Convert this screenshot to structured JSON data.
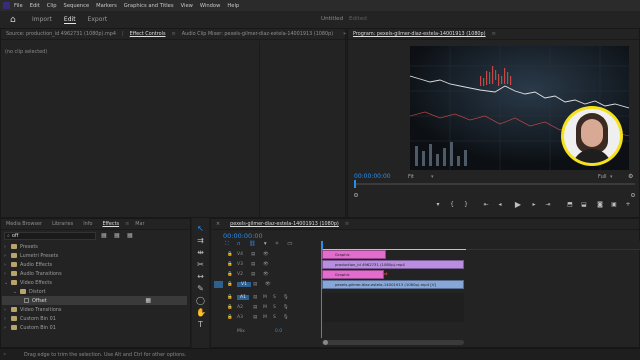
{
  "menu": [
    "File",
    "Edit",
    "Clip",
    "Sequence",
    "Markers",
    "Graphics and Titles",
    "View",
    "Window",
    "Help"
  ],
  "workspace": {
    "tabs": [
      "Import",
      "Edit",
      "Export"
    ],
    "active_tab": "Edit",
    "project_name": "Untitled",
    "status": "Edited"
  },
  "source_panel": {
    "tabs": [
      "Source: production_id 4962731 (1080p).mp4",
      "Effect Controls",
      "Audio Clip Mixer: pexels-gilmer-diaz-estela-14001913 (1080p)"
    ],
    "active_tab": "Effect Controls",
    "empty_text": "(no clip selected)"
  },
  "program_panel": {
    "title": "Program: pexels-gilmer-diaz-estela-14001913 (1080p)",
    "timecode": "00:00:00:00",
    "fit": "Fit",
    "quality": "Full"
  },
  "effects_panel": {
    "tabs": [
      "Media Browser",
      "Libraries",
      "Info",
      "Effects",
      "Mar"
    ],
    "active_tab": "Effects",
    "search_value": "off",
    "items": [
      {
        "label": "Presets",
        "indent": 0,
        "open": false
      },
      {
        "label": "Lumetri Presets",
        "indent": 0,
        "open": false
      },
      {
        "label": "Audio Effects",
        "indent": 0,
        "open": false
      },
      {
        "label": "Audio Transitions",
        "indent": 0,
        "open": false
      },
      {
        "label": "Video Effects",
        "indent": 0,
        "open": true
      },
      {
        "label": "Distort",
        "indent": 1,
        "open": true
      },
      {
        "label": "Offset",
        "indent": 2,
        "open": false,
        "selected": true
      },
      {
        "label": "Video Transitions",
        "indent": 0,
        "open": false
      },
      {
        "label": "Custom Bin 01",
        "indent": 0,
        "open": false
      },
      {
        "label": "Custom Bin 01",
        "indent": 0,
        "open": false
      }
    ]
  },
  "timeline": {
    "sequence_tab": "pexels-gilmer-diaz-estela-14001913 (1080p)",
    "timecode": "00:00:00:00",
    "tracks": [
      {
        "name": "V4"
      },
      {
        "name": "V3"
      },
      {
        "name": "V2"
      },
      {
        "name": "V1"
      },
      {
        "name": "A1"
      },
      {
        "name": "A2"
      },
      {
        "name": "A3"
      }
    ],
    "mix_label": "Mix",
    "mix_value": "0.0",
    "clips": [
      {
        "label": "Graphic",
        "color": "#e26dcf"
      },
      {
        "label": "production_id 4962731 (1080p).mp4",
        "color": "#b98de0"
      },
      {
        "label": "Graphic",
        "color": "#e26dcf"
      },
      {
        "label": "pexels-gilmer-diaz-estela-14001913 (1080p).mp4 [V]",
        "color": "#86a7d8"
      }
    ]
  },
  "status_bar": {
    "hint": "Drag edge to trim the selection. Use Alt and Ctrl for other options."
  },
  "colors": {
    "accent": "#2d8ceb",
    "yellow_ring": "#f5e21b"
  }
}
